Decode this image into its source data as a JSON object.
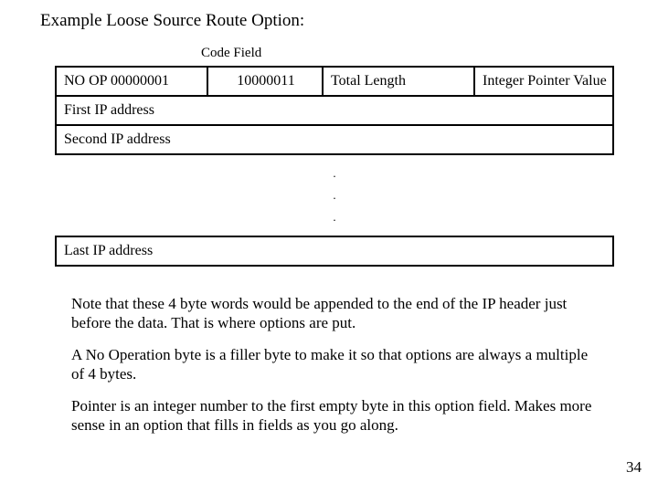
{
  "title": "Example Loose Source Route Option:",
  "code_label": "Code Field",
  "header": {
    "noop": "NO OP 00000001",
    "code": "10000011",
    "length": "Total Length",
    "pointer": "Integer Pointer Value"
  },
  "rows": {
    "first": "First IP address",
    "second": "Second IP address",
    "last": "Last IP address"
  },
  "dots": [
    ".",
    ".",
    "."
  ],
  "paragraphs": {
    "p1": "Note that these 4 byte words would be appended to the end of the IP header just before the data. That is where options are put.",
    "p2": "A No Operation byte is a filler byte to make it so that options are always a multiple of 4 bytes.",
    "p3": "Pointer is an integer number to the first empty byte in this option field. Makes more sense in an option that fills in fields as you go along."
  },
  "page_number": "34"
}
